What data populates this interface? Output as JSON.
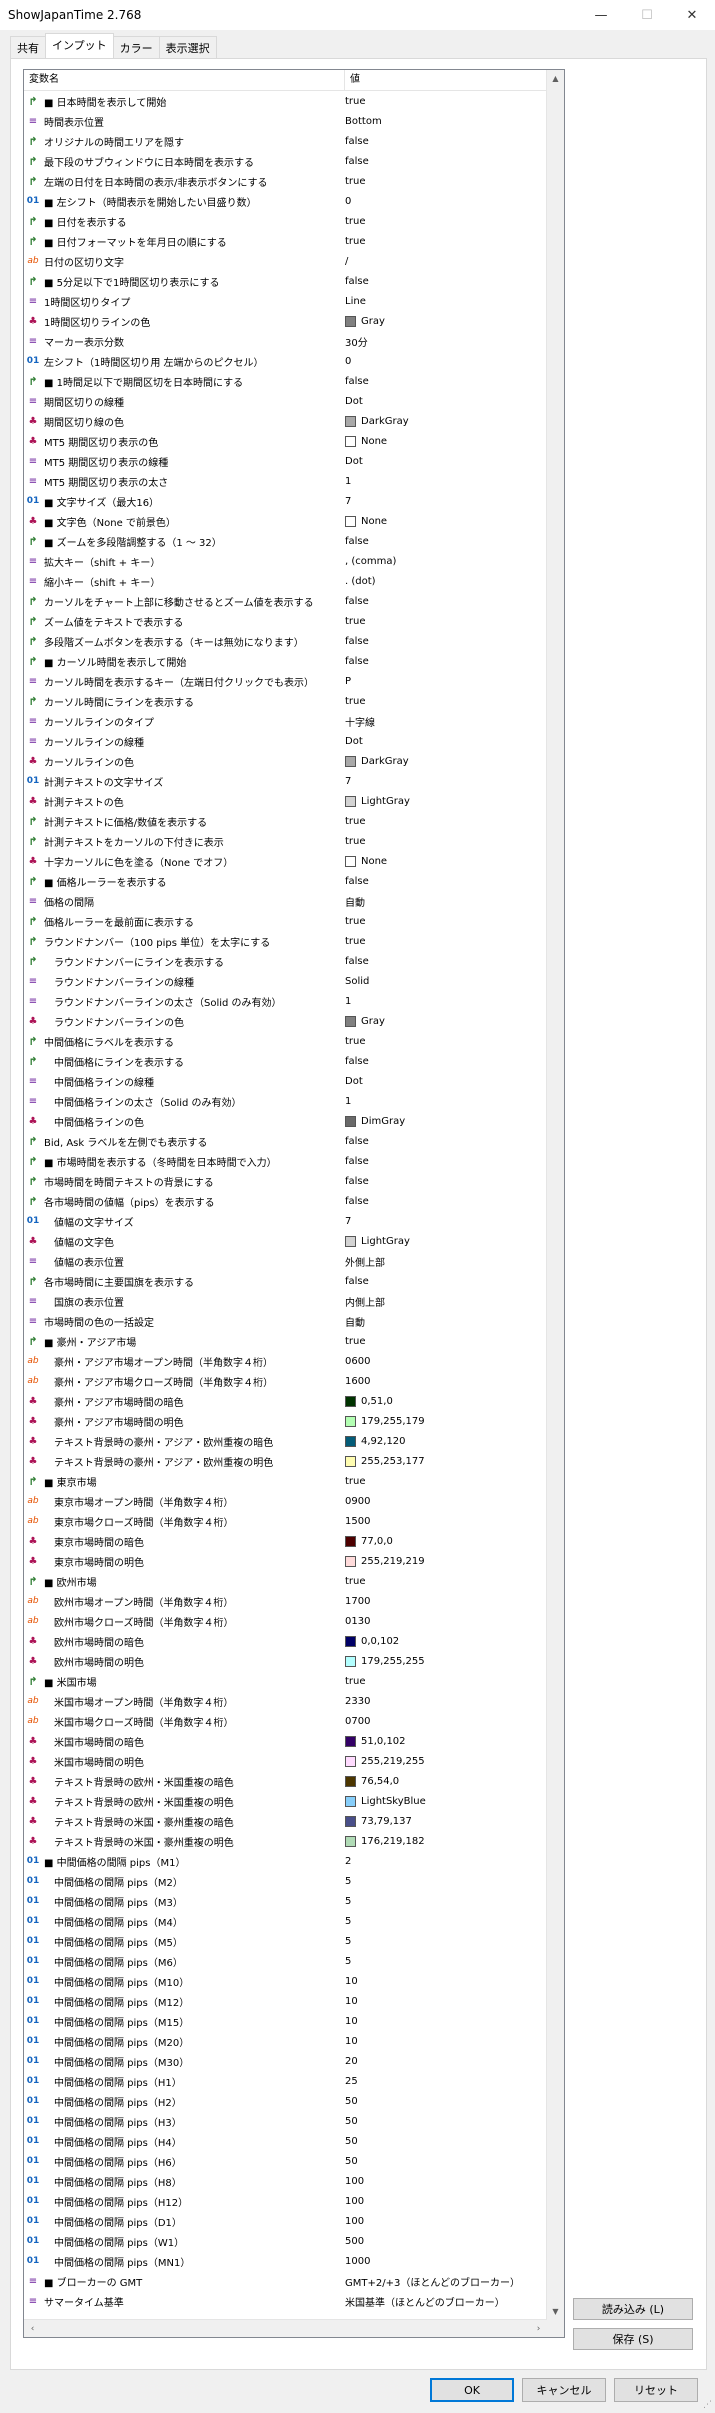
{
  "window": {
    "title": "ShowJapanTime 2.768"
  },
  "tabs": [
    {
      "label": "共有"
    },
    {
      "label": "インプット",
      "active": true
    },
    {
      "label": "カラー"
    },
    {
      "label": "表示選択"
    }
  ],
  "grid": {
    "col_name": "変数名",
    "col_value": "値",
    "rows": [
      {
        "icon": "bool",
        "name": "■ 日本時間を表示して開始",
        "value": "true"
      },
      {
        "icon": "enum",
        "name": "時間表示位置",
        "value": "Bottom"
      },
      {
        "icon": "bool",
        "name": "オリジナルの時間エリアを隠す",
        "value": "false"
      },
      {
        "icon": "bool",
        "name": "最下段のサブウィンドウに日本時間を表示する",
        "value": "false"
      },
      {
        "icon": "bool",
        "name": "左端の日付を日本時間の表示/非表示ボタンにする",
        "value": "true"
      },
      {
        "icon": "num",
        "name": "■ 左シフト（時間表示を開始したい目盛り数）",
        "value": "0"
      },
      {
        "icon": "bool",
        "name": "■ 日付を表示する",
        "value": "true"
      },
      {
        "icon": "bool",
        "name": "■ 日付フォーマットを年月日の順にする",
        "value": "true"
      },
      {
        "icon": "str",
        "name": "日付の区切り文字",
        "value": "/"
      },
      {
        "icon": "bool",
        "name": "■ 5分足以下で1時間区切り表示にする",
        "value": "false"
      },
      {
        "icon": "enum",
        "name": "1時間区切りタイプ",
        "value": "Line"
      },
      {
        "icon": "color",
        "name": "1時間区切りラインの色",
        "value": "Gray",
        "swatch": "#808080"
      },
      {
        "icon": "enum",
        "name": "マーカー表示分数",
        "value": "30分"
      },
      {
        "icon": "num",
        "name": "左シフト（1時間区切り用 左端からのピクセル）",
        "value": "0"
      },
      {
        "icon": "bool",
        "name": "■ 1時間足以下で期間区切を日本時間にする",
        "value": "false"
      },
      {
        "icon": "enum",
        "name": "期間区切りの線種",
        "value": "Dot"
      },
      {
        "icon": "color",
        "name": "期間区切り線の色",
        "value": "DarkGray",
        "swatch": "#a9a9a9"
      },
      {
        "icon": "color",
        "name": "MT5 期間区切り表示の色",
        "value": "None",
        "swatch": "#ffffff"
      },
      {
        "icon": "enum",
        "name": "MT5 期間区切り表示の線種",
        "value": "Dot"
      },
      {
        "icon": "enum",
        "name": "MT5 期間区切り表示の太さ",
        "value": "1"
      },
      {
        "icon": "num",
        "name": "■ 文字サイズ（最大16）",
        "value": "7"
      },
      {
        "icon": "color",
        "name": "■ 文字色（None で前景色）",
        "value": "None",
        "swatch": "#ffffff"
      },
      {
        "icon": "bool",
        "name": "■ ズームを多段階調整する（1 ～ 32）",
        "value": "false"
      },
      {
        "icon": "enum",
        "name": "拡大キー（shift + キー）",
        "value": ", (comma)"
      },
      {
        "icon": "enum",
        "name": "縮小キー（shift + キー）",
        "value": ". (dot)"
      },
      {
        "icon": "bool",
        "name": "カーソルをチャート上部に移動させるとズーム値を表示する",
        "value": "false"
      },
      {
        "icon": "bool",
        "name": "ズーム値をテキストで表示する",
        "value": "true"
      },
      {
        "icon": "bool",
        "name": "多段階ズームボタンを表示する（キーは無効になります）",
        "value": "false"
      },
      {
        "icon": "bool",
        "name": "■ カーソル時間を表示して開始",
        "value": "false"
      },
      {
        "icon": "enum",
        "name": "カーソル時間を表示するキー（左端日付クリックでも表示）",
        "value": "P"
      },
      {
        "icon": "bool",
        "name": "カーソル時間にラインを表示する",
        "value": "true"
      },
      {
        "icon": "enum",
        "name": "カーソルラインのタイプ",
        "value": "十字線"
      },
      {
        "icon": "enum",
        "name": "カーソルラインの線種",
        "value": "Dot"
      },
      {
        "icon": "color",
        "name": "カーソルラインの色",
        "value": "DarkGray",
        "swatch": "#a9a9a9"
      },
      {
        "icon": "num",
        "name": "計測テキストの文字サイズ",
        "value": "7"
      },
      {
        "icon": "color",
        "name": "計測テキストの色",
        "value": "LightGray",
        "swatch": "#d3d3d3"
      },
      {
        "icon": "bool",
        "name": "計測テキストに価格/数値を表示する",
        "value": "true"
      },
      {
        "icon": "bool",
        "name": "計測テキストをカーソルの下付きに表示",
        "value": "true"
      },
      {
        "icon": "color",
        "name": "十字カーソルに色を塗る（None でオフ）",
        "value": "None",
        "swatch": "#ffffff"
      },
      {
        "icon": "bool",
        "name": "■ 価格ルーラーを表示する",
        "value": "false"
      },
      {
        "icon": "enum",
        "name": "価格の間隔",
        "value": "自動"
      },
      {
        "icon": "bool",
        "name": "価格ルーラーを最前面に表示する",
        "value": "true"
      },
      {
        "icon": "bool",
        "name": "ラウンドナンバー（100 pips 単位）を太字にする",
        "value": "true"
      },
      {
        "icon": "bool",
        "name": "　ラウンドナンバーにラインを表示する",
        "value": "false"
      },
      {
        "icon": "enum",
        "name": "　ラウンドナンバーラインの線種",
        "value": "Solid"
      },
      {
        "icon": "enum",
        "name": "　ラウンドナンバーラインの太さ（Solid のみ有効）",
        "value": "1"
      },
      {
        "icon": "color",
        "name": "　ラウンドナンバーラインの色",
        "value": "Gray",
        "swatch": "#808080"
      },
      {
        "icon": "bool",
        "name": "中間価格にラベルを表示する",
        "value": "true"
      },
      {
        "icon": "bool",
        "name": "　中間価格にラインを表示する",
        "value": "false"
      },
      {
        "icon": "enum",
        "name": "　中間価格ラインの線種",
        "value": "Dot"
      },
      {
        "icon": "enum",
        "name": "　中間価格ラインの太さ（Solid のみ有効）",
        "value": "1"
      },
      {
        "icon": "color",
        "name": "　中間価格ラインの色",
        "value": "DimGray",
        "swatch": "#696969"
      },
      {
        "icon": "bool",
        "name": "Bid, Ask ラベルを左側でも表示する",
        "value": "false"
      },
      {
        "icon": "bool",
        "name": "■ 市場時間を表示する（冬時間を日本時間で入力）",
        "value": "false"
      },
      {
        "icon": "bool",
        "name": "市場時間を時間テキストの背景にする",
        "value": "false"
      },
      {
        "icon": "bool",
        "name": "各市場時間の値幅（pips）を表示する",
        "value": "false"
      },
      {
        "icon": "num",
        "name": "　値幅の文字サイズ",
        "value": "7"
      },
      {
        "icon": "color",
        "name": "　値幅の文字色",
        "value": "LightGray",
        "swatch": "#d3d3d3"
      },
      {
        "icon": "enum",
        "name": "　値幅の表示位置",
        "value": "外側上部"
      },
      {
        "icon": "bool",
        "name": "各市場時間に主要国旗を表示する",
        "value": "false"
      },
      {
        "icon": "enum",
        "name": "　国旗の表示位置",
        "value": "内側上部"
      },
      {
        "icon": "enum",
        "name": "市場時間の色の一括設定",
        "value": "自動"
      },
      {
        "icon": "bool",
        "name": "■ 豪州・アジア市場",
        "value": "true"
      },
      {
        "icon": "str",
        "name": "　豪州・アジア市場オープン時間（半角数字４桁）",
        "value": "0600"
      },
      {
        "icon": "str",
        "name": "　豪州・アジア市場クローズ時間（半角数字４桁）",
        "value": "1600"
      },
      {
        "icon": "color",
        "name": "　豪州・アジア市場時間の暗色",
        "value": "0,51,0",
        "swatch": "#003300"
      },
      {
        "icon": "color",
        "name": "　豪州・アジア市場時間の明色",
        "value": "179,255,179",
        "swatch": "#b3ffb3"
      },
      {
        "icon": "color",
        "name": "　テキスト背景時の豪州・アジア・欧州重複の暗色",
        "value": "4,92,120",
        "swatch": "#045c78"
      },
      {
        "icon": "color",
        "name": "　テキスト背景時の豪州・アジア・欧州重複の明色",
        "value": "255,253,177",
        "swatch": "#fffdb1"
      },
      {
        "icon": "bool",
        "name": "■ 東京市場",
        "value": "true"
      },
      {
        "icon": "str",
        "name": "　東京市場オープン時間（半角数字４桁）",
        "value": "0900"
      },
      {
        "icon": "str",
        "name": "　東京市場クローズ時間（半角数字４桁）",
        "value": "1500"
      },
      {
        "icon": "color",
        "name": "　東京市場時間の暗色",
        "value": "77,0,0",
        "swatch": "#4d0000"
      },
      {
        "icon": "color",
        "name": "　東京市場時間の明色",
        "value": "255,219,219",
        "swatch": "#ffdbdb"
      },
      {
        "icon": "bool",
        "name": "■ 欧州市場",
        "value": "true"
      },
      {
        "icon": "str",
        "name": "　欧州市場オープン時間（半角数字４桁）",
        "value": "1700"
      },
      {
        "icon": "str",
        "name": "　欧州市場クローズ時間（半角数字４桁）",
        "value": "0130"
      },
      {
        "icon": "color",
        "name": "　欧州市場時間の暗色",
        "value": "0,0,102",
        "swatch": "#000066"
      },
      {
        "icon": "color",
        "name": "　欧州市場時間の明色",
        "value": "179,255,255",
        "swatch": "#b3ffff"
      },
      {
        "icon": "bool",
        "name": "■ 米国市場",
        "value": "true"
      },
      {
        "icon": "str",
        "name": "　米国市場オープン時間（半角数字４桁）",
        "value": "2330"
      },
      {
        "icon": "str",
        "name": "　米国市場クローズ時間（半角数字４桁）",
        "value": "0700"
      },
      {
        "icon": "color",
        "name": "　米国市場時間の暗色",
        "value": "51,0,102",
        "swatch": "#330066"
      },
      {
        "icon": "color",
        "name": "　米国市場時間の明色",
        "value": "255,219,255",
        "swatch": "#ffdbff"
      },
      {
        "icon": "color",
        "name": "　テキスト背景時の欧州・米国重複の暗色",
        "value": "76,54,0",
        "swatch": "#4c3600"
      },
      {
        "icon": "color",
        "name": "　テキスト背景時の欧州・米国重複の明色",
        "value": "LightSkyBlue",
        "swatch": "#87cefa"
      },
      {
        "icon": "color",
        "name": "　テキスト背景時の米国・豪州重複の暗色",
        "value": "73,79,137",
        "swatch": "#494f89"
      },
      {
        "icon": "color",
        "name": "　テキスト背景時の米国・豪州重複の明色",
        "value": "176,219,182",
        "swatch": "#b0dbb6"
      },
      {
        "icon": "num",
        "name": "■ 中間価格の間隔 pips（M1）",
        "value": "2"
      },
      {
        "icon": "num",
        "name": "　中間価格の間隔 pips（M2）",
        "value": "5"
      },
      {
        "icon": "num",
        "name": "　中間価格の間隔 pips（M3）",
        "value": "5"
      },
      {
        "icon": "num",
        "name": "　中間価格の間隔 pips（M4）",
        "value": "5"
      },
      {
        "icon": "num",
        "name": "　中間価格の間隔 pips（M5）",
        "value": "5"
      },
      {
        "icon": "num",
        "name": "　中間価格の間隔 pips（M6）",
        "value": "5"
      },
      {
        "icon": "num",
        "name": "　中間価格の間隔 pips（M10）",
        "value": "10"
      },
      {
        "icon": "num",
        "name": "　中間価格の間隔 pips（M12）",
        "value": "10"
      },
      {
        "icon": "num",
        "name": "　中間価格の間隔 pips（M15）",
        "value": "10"
      },
      {
        "icon": "num",
        "name": "　中間価格の間隔 pips（M20）",
        "value": "10"
      },
      {
        "icon": "num",
        "name": "　中間価格の間隔 pips（M30）",
        "value": "20"
      },
      {
        "icon": "num",
        "name": "　中間価格の間隔 pips（H1）",
        "value": "25"
      },
      {
        "icon": "num",
        "name": "　中間価格の間隔 pips（H2）",
        "value": "50"
      },
      {
        "icon": "num",
        "name": "　中間価格の間隔 pips（H3）",
        "value": "50"
      },
      {
        "icon": "num",
        "name": "　中間価格の間隔 pips（H4）",
        "value": "50"
      },
      {
        "icon": "num",
        "name": "　中間価格の間隔 pips（H6）",
        "value": "50"
      },
      {
        "icon": "num",
        "name": "　中間価格の間隔 pips（H8）",
        "value": "100"
      },
      {
        "icon": "num",
        "name": "　中間価格の間隔 pips（H12）",
        "value": "100"
      },
      {
        "icon": "num",
        "name": "　中間価格の間隔 pips（D1）",
        "value": "100"
      },
      {
        "icon": "num",
        "name": "　中間価格の間隔 pips（W1）",
        "value": "500"
      },
      {
        "icon": "num",
        "name": "　中間価格の間隔 pips（MN1）",
        "value": "1000"
      },
      {
        "icon": "enum",
        "name": "■ ブローカーの GMT",
        "value": "GMT+2/+3（ほとんどのブローカー）"
      },
      {
        "icon": "enum",
        "name": "サマータイム基準",
        "value": "米国基準（ほとんどのブローカー）"
      }
    ]
  },
  "buttons": {
    "load": "読み込み (L)",
    "save": "保存 (S)",
    "ok": "OK",
    "cancel": "キャンセル",
    "reset": "リセット"
  },
  "icons": {
    "bool": "↱",
    "num": "01",
    "str": "ab",
    "enum": "≡",
    "color": "♣"
  },
  "window_controls": {
    "minimize": "—",
    "maximize": "☐",
    "close": "✕"
  }
}
